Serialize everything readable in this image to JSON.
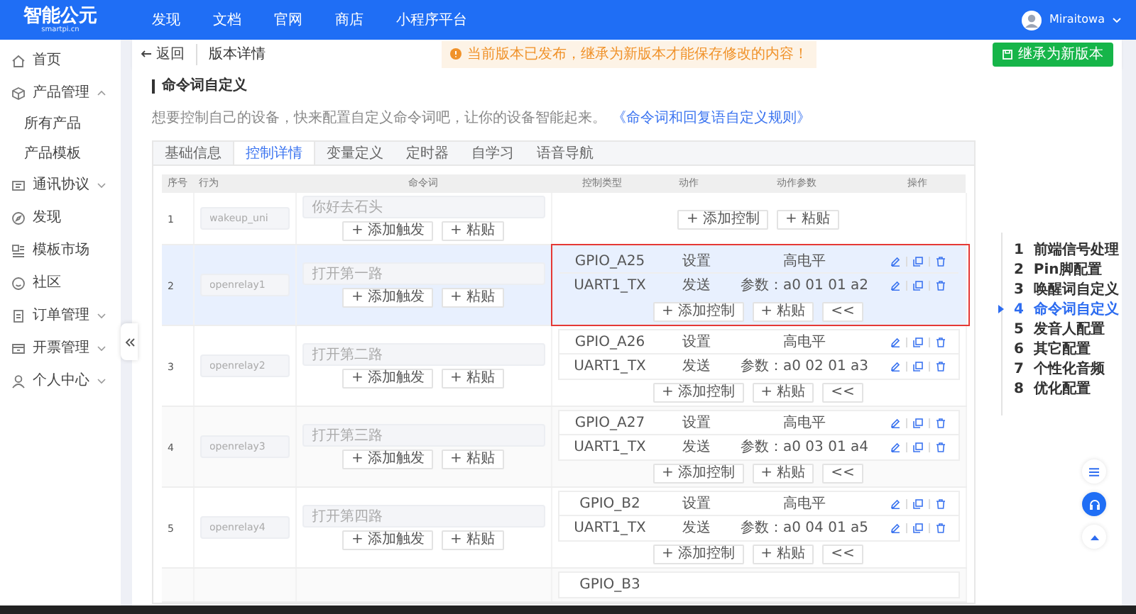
{
  "topbar": {
    "logo": "智能公元",
    "logo_sub": "smartpi.cn",
    "nav": [
      "发现",
      "文档",
      "官网",
      "商店",
      "小程序平台"
    ],
    "user": "Miraitowa"
  },
  "sidebar": {
    "items": [
      {
        "label": "首页",
        "kind": "link"
      },
      {
        "label": "产品管理",
        "kind": "group",
        "expanded": true,
        "children": [
          {
            "label": "所有产品"
          },
          {
            "label": "产品模板"
          }
        ]
      },
      {
        "label": "通讯协议",
        "kind": "group",
        "expanded": false
      },
      {
        "label": "发现",
        "kind": "link"
      },
      {
        "label": "模板市场",
        "kind": "link"
      },
      {
        "label": "社区",
        "kind": "link"
      },
      {
        "label": "订单管理",
        "kind": "group",
        "expanded": false
      },
      {
        "label": "开票管理",
        "kind": "group",
        "expanded": false
      },
      {
        "label": "个人中心",
        "kind": "group",
        "expanded": false
      }
    ]
  },
  "header": {
    "back": "返回",
    "title": "版本详情",
    "notice": "当前版本已发布，继承为新版本才能保存修改的内容！",
    "action": "继承为新版本"
  },
  "section": {
    "title": "命令词自定义",
    "description": "想要控制自己的设备，快来配置自定义命令词吧，让你的设备智能起来。",
    "link": "《命令词和回复语自定义规则》"
  },
  "tabs": [
    {
      "label": "基础信息",
      "selected": false
    },
    {
      "label": "控制详情",
      "selected": true
    },
    {
      "label": "变量定义",
      "selected": false
    },
    {
      "label": "定时器",
      "selected": false
    },
    {
      "label": "自学习",
      "selected": false
    },
    {
      "label": "语音导航",
      "selected": false
    }
  ],
  "table": {
    "columns": [
      "序号",
      "行为",
      "命令词",
      "控制类型",
      "动作",
      "动作参数",
      "操作"
    ],
    "rows": [
      {
        "index": "1",
        "behavior": "wakeup_uni",
        "command": "你好去石头",
        "hovered": false,
        "outlined": false,
        "add_trigger": "+ 添加触发",
        "paste_trigger": "+ 粘贴",
        "controls": [],
        "add_control": "+ 添加控制",
        "paste_control": "+ 粘贴"
      },
      {
        "index": "2",
        "behavior": "openrelay1",
        "command": "打开第一路",
        "hovered": true,
        "outlined": true,
        "add_trigger": "+ 添加触发",
        "paste_trigger": "+ 粘贴",
        "controls": [
          {
            "type": "GPIO_A25",
            "action": "设置",
            "param": "高电平"
          },
          {
            "type": "UART1_TX",
            "action": "发送",
            "param": "参数：a0 01 01 a2"
          }
        ],
        "add_control": "+ 添加控制",
        "paste_control": "+ 粘贴",
        "collapse": "<<"
      },
      {
        "index": "3",
        "behavior": "openrelay2",
        "command": "打开第二路",
        "hovered": false,
        "outlined": false,
        "add_trigger": "+ 添加触发",
        "paste_trigger": "+ 粘贴",
        "controls": [
          {
            "type": "GPIO_A26",
            "action": "设置",
            "param": "高电平"
          },
          {
            "type": "UART1_TX",
            "action": "发送",
            "param": "参数：a0 02 01 a3"
          }
        ],
        "add_control": "+ 添加控制",
        "paste_control": "+ 粘贴",
        "collapse": "<<"
      },
      {
        "index": "4",
        "behavior": "openrelay3",
        "command": "打开第三路",
        "hovered": false,
        "outlined": false,
        "add_trigger": "+ 添加触发",
        "paste_trigger": "+ 粘贴",
        "controls": [
          {
            "type": "GPIO_A27",
            "action": "设置",
            "param": "高电平"
          },
          {
            "type": "UART1_TX",
            "action": "发送",
            "param": "参数：a0 03 01 a4"
          }
        ],
        "add_control": "+ 添加控制",
        "paste_control": "+ 粘贴",
        "collapse": "<<"
      },
      {
        "index": "5",
        "behavior": "openrelay4",
        "command": "打开第四路",
        "hovered": false,
        "outlined": false,
        "add_trigger": "+ 添加触发",
        "paste_trigger": "+ 粘贴",
        "controls": [
          {
            "type": "GPIO_B2",
            "action": "设置",
            "param": "高电平"
          },
          {
            "type": "UART1_TX",
            "action": "发送",
            "param": "参数：a0 04 01 a5"
          }
        ],
        "add_control": "+ 添加控制",
        "paste_control": "+ 粘贴",
        "collapse": "<<"
      },
      {
        "hovered": false,
        "outlined": false,
        "controls": [
          {
            "type": "GPIO_B3"
          }
        ]
      }
    ]
  },
  "anchor_nav": [
    {
      "number": "1",
      "label": "前端信号处理",
      "selected": false
    },
    {
      "number": "2",
      "label": "Pin脚配置",
      "selected": false
    },
    {
      "number": "3",
      "label": "唤醒词自定义",
      "selected": false
    },
    {
      "number": "4",
      "label": "命令词自定义",
      "selected": true
    },
    {
      "number": "5",
      "label": "发音人配置",
      "selected": false
    },
    {
      "number": "6",
      "label": "其它配置",
      "selected": false
    },
    {
      "number": "7",
      "label": "个性化音频",
      "selected": false
    },
    {
      "number": "8",
      "label": "优化配置",
      "selected": false
    }
  ]
}
